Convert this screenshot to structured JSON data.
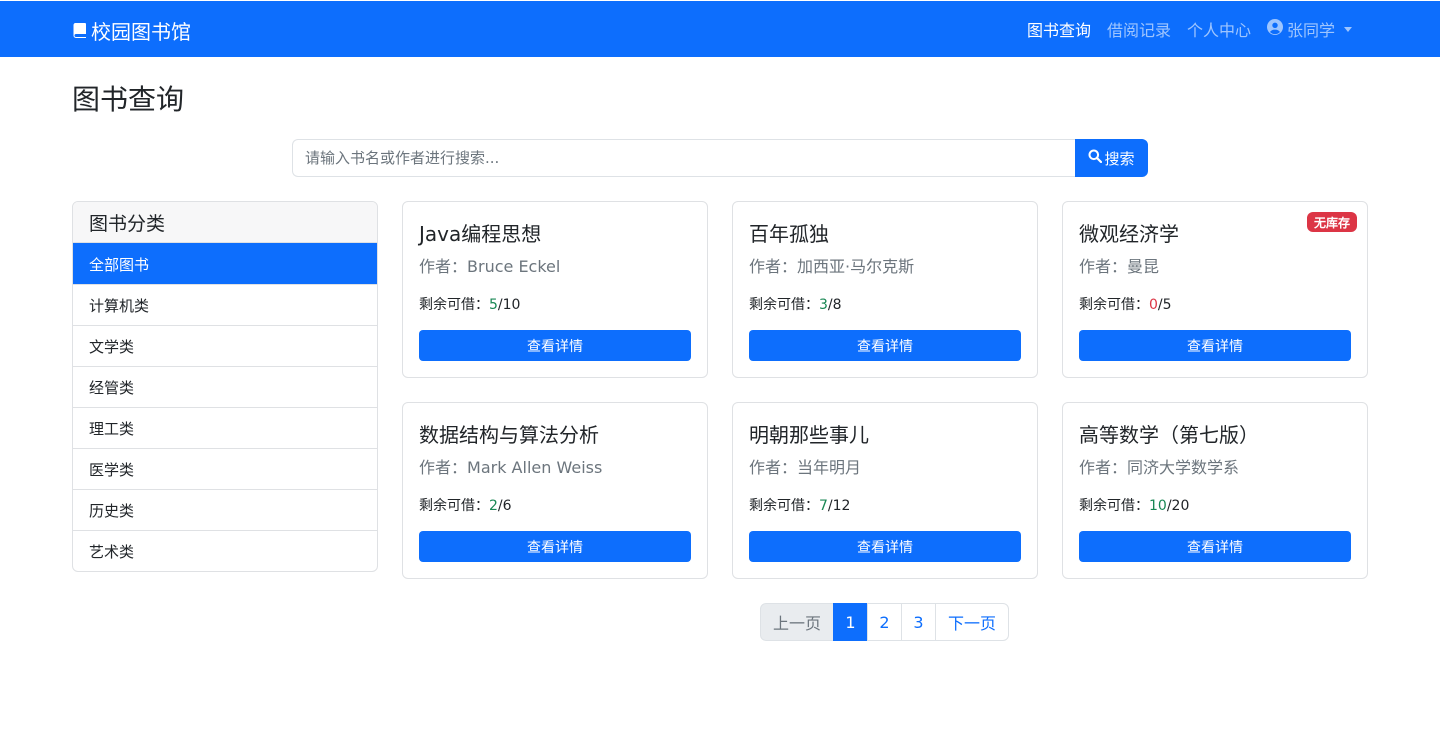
{
  "navbar": {
    "brand": "校园图书馆",
    "links": [
      "图书查询",
      "借阅记录",
      "个人中心"
    ],
    "user": "张同学"
  },
  "page_title": "图书查询",
  "search": {
    "placeholder": "请输入书名或作者进行搜索...",
    "button": "搜索"
  },
  "sidebar": {
    "header": "图书分类",
    "items": [
      "全部图书",
      "计算机类",
      "文学类",
      "经管类",
      "理工类",
      "医学类",
      "历史类",
      "艺术类"
    ]
  },
  "stock_label": "剩余可借：",
  "author_label": "作者：",
  "detail_button": "查看详情",
  "books": [
    {
      "title": "Java编程思想",
      "author": "Bruce Eckel",
      "available": "5",
      "total": "/10",
      "badge": ""
    },
    {
      "title": "百年孤独",
      "author": "加西亚·马尔克斯",
      "available": "3",
      "total": "/8",
      "badge": ""
    },
    {
      "title": "微观经济学",
      "author": "曼昆",
      "available": "0",
      "total": "/5",
      "badge": "无库存"
    },
    {
      "title": "数据结构与算法分析",
      "author": "Mark Allen Weiss",
      "available": "2",
      "total": "/6",
      "badge": ""
    },
    {
      "title": "明朝那些事儿",
      "author": "当年明月",
      "available": "7",
      "total": "/12",
      "badge": ""
    },
    {
      "title": "高等数学（第七版）",
      "author": "同济大学数学系",
      "available": "10",
      "total": "/20",
      "badge": ""
    }
  ],
  "pagination": {
    "prev": "上一页",
    "pages": [
      "1",
      "2",
      "3"
    ],
    "next": "下一页"
  },
  "colors": {
    "primary": "#0d6efd",
    "available": "#198754",
    "danger": "#dc3545"
  }
}
